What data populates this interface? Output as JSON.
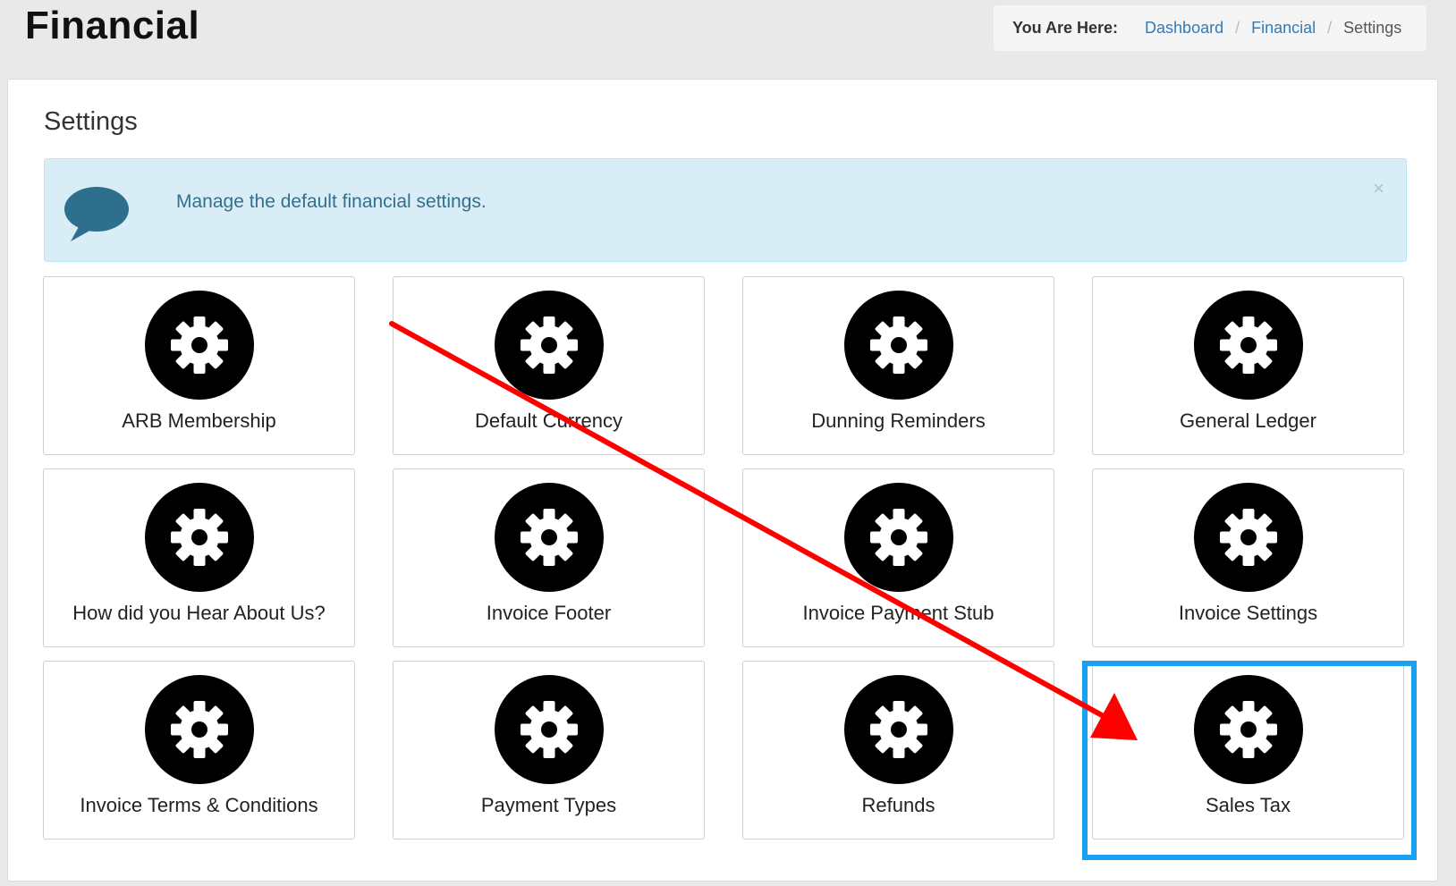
{
  "header": {
    "title": "Financial"
  },
  "breadcrumb": {
    "lead": "You Are Here:",
    "items": [
      {
        "label": "Dashboard",
        "link": true
      },
      {
        "label": "Financial",
        "link": true
      },
      {
        "label": "Settings",
        "link": false
      }
    ],
    "separator": "/"
  },
  "panel": {
    "heading": "Settings"
  },
  "alert": {
    "icon": "speech-bubble-icon",
    "message": "Manage the default financial settings.",
    "close_label": "×"
  },
  "tiles": [
    {
      "label": "ARB Membership",
      "icon": "gear-icon"
    },
    {
      "label": "Default Currency",
      "icon": "gear-icon"
    },
    {
      "label": "Dunning Reminders",
      "icon": "gear-icon"
    },
    {
      "label": "General Ledger",
      "icon": "gear-icon"
    },
    {
      "label": "How did you Hear About Us?",
      "icon": "gear-icon"
    },
    {
      "label": "Invoice Footer",
      "icon": "gear-icon"
    },
    {
      "label": "Invoice Payment Stub",
      "icon": "gear-icon"
    },
    {
      "label": "Invoice Settings",
      "icon": "gear-icon"
    },
    {
      "label": "Invoice Terms & Conditions",
      "icon": "gear-icon"
    },
    {
      "label": "Payment Types",
      "icon": "gear-icon"
    },
    {
      "label": "Refunds",
      "icon": "gear-icon"
    },
    {
      "label": "Sales Tax",
      "icon": "gear-icon",
      "highlighted": true
    }
  ],
  "annotation": {
    "arrow_color": "#ff0000",
    "highlight_color": "#1aa0f0"
  }
}
